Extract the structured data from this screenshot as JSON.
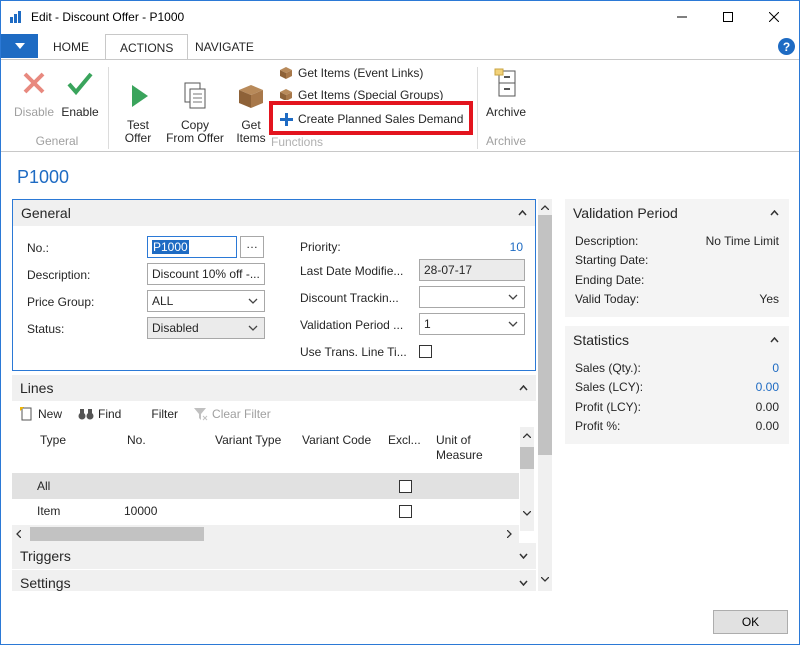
{
  "window": {
    "title": "Edit - Discount Offer - P1000"
  },
  "ribbon": {
    "tabs": [
      {
        "label": "HOME"
      },
      {
        "label": "ACTIONS"
      },
      {
        "label": "NAVIGATE"
      }
    ],
    "general": {
      "disable_label": "Disable",
      "enable_label": "Enable",
      "group_label": "General"
    },
    "functions": {
      "test_offer_label": "Test\nOffer",
      "copy_from_offer_label": "Copy\nFrom Offer",
      "get_items_label": "Get\nItems",
      "get_items_event_links": "Get Items (Event Links)",
      "get_items_special_groups": "Get Items (Special Groups)",
      "create_planned_sales_demand": "Create Planned Sales Demand",
      "group_label": "Functions"
    },
    "archive": {
      "archive_label": "Archive",
      "group_label": "Archive"
    }
  },
  "page_title": "P1000",
  "general": {
    "header": "General",
    "no_label": "No.:",
    "no_value": "P1000",
    "description_label": "Description:",
    "description_value": "Discount 10% off -...",
    "price_group_label": "Price Group:",
    "price_group_value": "ALL",
    "status_label": "Status:",
    "status_value": "Disabled",
    "priority_label": "Priority:",
    "priority_value": "10",
    "last_date_label": "Last Date Modifie...",
    "last_date_value": "28-07-17",
    "discount_tracking_label": "Discount Trackin...",
    "discount_tracking_value": "",
    "validation_period_label": "Validation Period ...",
    "validation_period_value": "1",
    "use_trans_label": "Use Trans. Line Ti..."
  },
  "lines": {
    "header": "Lines",
    "toolbar": {
      "new": "New",
      "find": "Find",
      "filter": "Filter",
      "clear_filter": "Clear Filter"
    },
    "columns": [
      "Type",
      "No.",
      "Variant Type",
      "Variant Code",
      "Excl...",
      "Unit of Measure"
    ],
    "rows": [
      {
        "type": "All",
        "no": ""
      },
      {
        "type": "Item",
        "no": "10000"
      }
    ]
  },
  "triggers": {
    "header": "Triggers"
  },
  "settings": {
    "header": "Settings"
  },
  "validation_period": {
    "header": "Validation Period",
    "description_label": "Description:",
    "description_value": "No Time Limit",
    "starting_date_label": "Starting Date:",
    "ending_date_label": "Ending Date:",
    "valid_today_label": "Valid Today:",
    "valid_today_value": "Yes"
  },
  "statistics": {
    "header": "Statistics",
    "sales_qty_label": "Sales (Qty.):",
    "sales_qty_value": "0",
    "sales_lcy_label": "Sales (LCY):",
    "sales_lcy_value": "0.00",
    "profit_lcy_label": "Profit (LCY):",
    "profit_lcy_value": "0.00",
    "profit_pct_label": "Profit %:",
    "profit_pct_value": "0.00"
  },
  "footer": {
    "ok_label": "OK"
  },
  "colors": {
    "accent": "#1e6bc3",
    "highlight": "#e3141e",
    "enable_green": "#3aa45c",
    "disable_red": "#e8897f"
  }
}
